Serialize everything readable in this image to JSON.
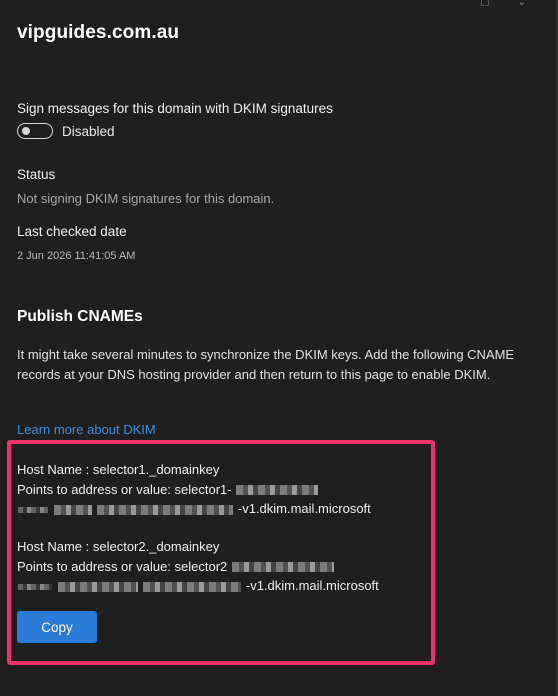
{
  "header": {
    "domain": "vipguides.com.au"
  },
  "dkim": {
    "sign_label": "Sign messages for this domain with DKIM signatures",
    "toggle_state": "Disabled",
    "status_label": "Status",
    "status_value": "Not signing DKIM signatures for this domain.",
    "last_checked_label": "Last checked date",
    "last_checked_value": "2 Jun 2026 11:41:05 AM"
  },
  "publish": {
    "heading": "Publish CNAMEs",
    "description": "It might take several minutes to synchronize the DKIM keys. Add the following CNAME records at your DNS hosting provider and then return to this page to enable DKIM.",
    "learn_more": "Learn more about DKIM"
  },
  "records": [
    {
      "host_label": "Host Name : selector1._domainkey",
      "points_prefix": "Points to address or value: selector1-",
      "points_suffix": "-v1.dkim.mail.microsoft"
    },
    {
      "host_label": "Host Name : selector2._domainkey",
      "points_prefix": "Points to address or value: selector2",
      "points_suffix": "-v1.dkim.mail.microsoft"
    }
  ],
  "actions": {
    "copy_label": "Copy"
  },
  "colors": {
    "background": "#1f1f1f",
    "accent": "#2a7ad8",
    "link": "#3f8ed8",
    "highlight": "#f0306a"
  }
}
